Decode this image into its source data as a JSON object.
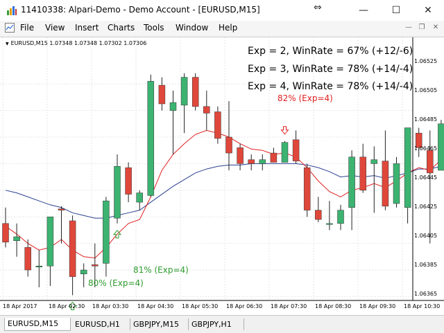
{
  "window": {
    "title": "11410338: Alpari-Demo - Demo Account - [EURUSD,M15]",
    "controls": {
      "minimize": "—",
      "maximize": "☐",
      "close": "✕"
    }
  },
  "menu": {
    "items": [
      "File",
      "View",
      "Insert",
      "Charts",
      "Tools",
      "Window",
      "Help"
    ]
  },
  "chart": {
    "symbol_line": "EURUSD,M15  1.07348 1.07348 1.07302 1.07306",
    "stats": [
      "Exp = 2, WinRate = 67% (+12/-6)",
      "Exp = 3, WinRate = 78% (+14/-4)",
      "Exp = 4, WinRate = 78% (+14/-4)"
    ],
    "price_labels": [
      "1.06525",
      "1.06505",
      "1.06485",
      "1.06465",
      "1.06445",
      "1.06425",
      "1.06405",
      "1.06385",
      "1.06365"
    ],
    "time_labels": [
      "18 Apr 2017",
      "18 Apr 02:30",
      "18 Apr 03:30",
      "18 Apr 04:30",
      "18 Apr 05:30",
      "18 Apr 06:30",
      "18 Apr 07:30",
      "18 Apr 08:30",
      "18 Apr 09:30",
      "18 Apr 10:30"
    ],
    "annotations": {
      "sell": "82% (Exp=4)",
      "buy1": "80% (Exp=4)",
      "buy2": "81% (Exp=4)"
    },
    "colors": {
      "bull": "#3cb371",
      "bear": "#e0473b",
      "fast_ma": "#e02020",
      "slow_ma": "#2a3f8f",
      "buy_arrow": "#2e9b2e",
      "sell_arrow": "#e02020"
    }
  },
  "chart_data": {
    "type": "candlestick",
    "symbol": "EURUSD",
    "timeframe": "M15",
    "candles": [
      {
        "o": 1.0642,
        "h": 1.06432,
        "l": 1.06402,
        "c": 1.06406
      },
      {
        "o": 1.06407,
        "h": 1.0642,
        "l": 1.06395,
        "c": 1.0641
      },
      {
        "o": 1.06402,
        "h": 1.06408,
        "l": 1.0638,
        "c": 1.06385
      },
      {
        "o": 1.06388,
        "h": 1.064,
        "l": 1.06372,
        "c": 1.06388
      },
      {
        "o": 1.06388,
        "h": 1.06425,
        "l": 1.06373,
        "c": 1.06425
      },
      {
        "o": 1.06431,
        "h": 1.06433,
        "l": 1.06405,
        "c": 1.0643
      },
      {
        "o": 1.06422,
        "h": 1.06426,
        "l": 1.06366,
        "c": 1.0638
      },
      {
        "o": 1.06382,
        "h": 1.0639,
        "l": 1.06372,
        "c": 1.06385
      },
      {
        "o": 1.06389,
        "h": 1.06405,
        "l": 1.06372,
        "c": 1.06388
      },
      {
        "o": 1.0639,
        "h": 1.0644,
        "l": 1.0638,
        "c": 1.06437
      },
      {
        "o": 1.06424,
        "h": 1.06472,
        "l": 1.0642,
        "c": 1.06463
      },
      {
        "o": 1.06462,
        "h": 1.06466,
        "l": 1.06436,
        "c": 1.06442
      },
      {
        "o": 1.06436,
        "h": 1.06445,
        "l": 1.0643,
        "c": 1.06443
      },
      {
        "o": 1.06441,
        "h": 1.06532,
        "l": 1.0644,
        "c": 1.06527
      },
      {
        "o": 1.06524,
        "h": 1.0653,
        "l": 1.06505,
        "c": 1.0651
      },
      {
        "o": 1.06505,
        "h": 1.0652,
        "l": 1.06472,
        "c": 1.06511
      },
      {
        "o": 1.06509,
        "h": 1.06533,
        "l": 1.06488,
        "c": 1.0653
      },
      {
        "o": 1.0653,
        "h": 1.06533,
        "l": 1.06505,
        "c": 1.06508
      },
      {
        "o": 1.06508,
        "h": 1.0652,
        "l": 1.0649,
        "c": 1.06503
      },
      {
        "o": 1.06504,
        "h": 1.06508,
        "l": 1.0648,
        "c": 1.06484
      },
      {
        "o": 1.06485,
        "h": 1.06512,
        "l": 1.0646,
        "c": 1.06473
      },
      {
        "o": 1.06477,
        "h": 1.0648,
        "l": 1.0646,
        "c": 1.06465
      },
      {
        "o": 1.06468,
        "h": 1.06472,
        "l": 1.0646,
        "c": 1.06465
      },
      {
        "o": 1.06465,
        "h": 1.06472,
        "l": 1.0646,
        "c": 1.06468
      },
      {
        "o": 1.06473,
        "h": 1.06477,
        "l": 1.06466,
        "c": 1.06466
      },
      {
        "o": 1.06466,
        "h": 1.06482,
        "l": 1.06466,
        "c": 1.06481
      },
      {
        "o": 1.06483,
        "h": 1.0649,
        "l": 1.06465,
        "c": 1.06467
      },
      {
        "o": 1.06462,
        "h": 1.06465,
        "l": 1.06425,
        "c": 1.0643
      },
      {
        "o": 1.0643,
        "h": 1.0644,
        "l": 1.06421,
        "c": 1.06423
      },
      {
        "o": 1.0642,
        "h": 1.06437,
        "l": 1.06415,
        "c": 1.0642
      },
      {
        "o": 1.0642,
        "h": 1.06434,
        "l": 1.06415,
        "c": 1.0643
      },
      {
        "o": 1.06432,
        "h": 1.06475,
        "l": 1.06415,
        "c": 1.0647
      },
      {
        "o": 1.0647,
        "h": 1.0648,
        "l": 1.06443,
        "c": 1.06445
      },
      {
        "o": 1.06465,
        "h": 1.06478,
        "l": 1.06428,
        "c": 1.06468
      },
      {
        "o": 1.06467,
        "h": 1.0649,
        "l": 1.0643,
        "c": 1.06433
      },
      {
        "o": 1.06435,
        "h": 1.0647,
        "l": 1.06432,
        "c": 1.06465
      },
      {
        "o": 1.06432,
        "h": 1.06478,
        "l": 1.0642,
        "c": 1.06492
      },
      {
        "o": 1.06488,
        "h": 1.06492,
        "l": 1.0647,
        "c": 1.06477
      },
      {
        "o": 1.06475,
        "h": 1.0649,
        "l": 1.06405,
        "c": 1.06458
      },
      {
        "o": 1.0646,
        "h": 1.06498,
        "l": 1.0646,
        "c": 1.06495
      }
    ],
    "ma_fast": [
      1.06418,
      1.06412,
      1.06405,
      1.064,
      1.06402,
      1.06408,
      1.064,
      1.06395,
      1.06394,
      1.06402,
      1.06412,
      1.0642,
      1.06423,
      1.0644,
      1.0646,
      1.06472,
      1.0648,
      1.06487,
      1.0649,
      1.06488,
      1.06485,
      1.0648,
      1.06476,
      1.06475,
      1.06472,
      1.06473,
      1.0647,
      1.06462,
      1.06452,
      1.06444,
      1.0644,
      1.06445,
      1.06447,
      1.0645,
      1.06447,
      1.06452,
      1.06458,
      1.06462,
      1.0646,
      1.06468
    ],
    "ma_slow": [
      1.06445,
      1.06443,
      1.0644,
      1.06437,
      1.06434,
      1.06432,
      1.06428,
      1.06426,
      1.06424,
      1.06424,
      1.06426,
      1.06428,
      1.0643,
      1.06436,
      1.06442,
      1.06448,
      1.06453,
      1.06458,
      1.06461,
      1.06463,
      1.06464,
      1.06464,
      1.06465,
      1.06465,
      1.06465,
      1.06465,
      1.06465,
      1.06464,
      1.06462,
      1.06459,
      1.06455,
      1.06456,
      1.06455,
      1.06456,
      1.06454,
      1.06456,
      1.06458,
      1.06461,
      1.06461,
      1.06463
    ],
    "signals": [
      {
        "type": "buy",
        "candle": 6,
        "label": "80% (Exp=4)"
      },
      {
        "type": "buy",
        "candle": 10,
        "label": "81% (Exp=4)"
      },
      {
        "type": "sell",
        "candle": 25,
        "label": "82% (Exp=4)"
      }
    ],
    "ylim": [
      1.0636,
      1.06535
    ],
    "grid": true
  },
  "tabs": [
    {
      "label": "EURUSD,M15",
      "active": true
    },
    {
      "label": "EURUSD,H1",
      "active": false
    },
    {
      "label": "GBPJPY,M15",
      "active": false
    },
    {
      "label": "GBPJPY,H1",
      "active": false
    }
  ]
}
